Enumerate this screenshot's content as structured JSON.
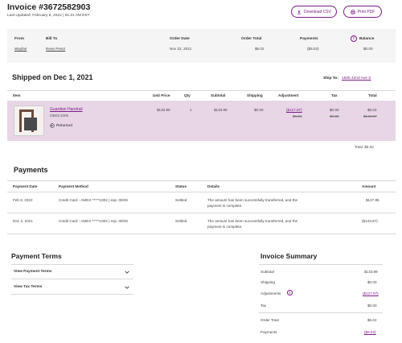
{
  "header": {
    "title": "Invoice #3672582903",
    "last_updated": "Last Updated: February 8, 2022 | 01:21 AM EST",
    "download_csv": "Download CSV",
    "print_pdf": "Print PDF"
  },
  "summary_bar": {
    "from_label": "From",
    "from_value": "Wayfair",
    "bill_to_label": "Bill To",
    "bill_to_value": "Rene Perez",
    "order_date_label": "Order Date",
    "order_date_value": "Nov 22, 2021",
    "order_total_label": "Order Total",
    "order_total_value": "$6.02",
    "payments_label": "Payments",
    "payments_value": "($6.02)",
    "balance_label": "Balance",
    "balance_value": "$0.00"
  },
  "shipment": {
    "heading": "Shipped on Dec 1, 2021",
    "ship_to_label": "Ship To:",
    "ship_to_value": "1505 42nd Ave S",
    "columns": [
      "Item",
      "Unit Price",
      "Qty",
      "Subtotal",
      "Shipping",
      "Adjustment",
      "Tax",
      "Total"
    ],
    "item": {
      "name": "Guardian Handrail",
      "sku": "OBDC1005",
      "status": "Returned",
      "unit_price": "$133.99",
      "qty": "1",
      "subtotal": "$133.99",
      "shipping": "$0.00",
      "adjustment_new": "($127.97)",
      "adjustment_old": "$0.00",
      "tax_new": "$0.00",
      "tax_old": "$9.88",
      "total_new": "$6.02",
      "total_old": "$143.87"
    },
    "total_line": "Total: $6.02"
  },
  "payments": {
    "heading": "Payments",
    "columns": [
      "Payment Date",
      "Payment Method",
      "Status",
      "Details",
      "Amount"
    ],
    "rows": [
      {
        "date": "Feb 8, 2022",
        "method": "Credit Card - AMEX *****1002 | exp. 09/26",
        "status": "Settled",
        "details_line1": "The amount has been successfully transferred, and the",
        "details_line2": "payment is complete.",
        "amount": "$127.85"
      },
      {
        "date": "Dec 2, 2021",
        "method": "Credit Card - AMEX *****1002 | exp. 09/26",
        "status": "Settled",
        "details_line1": "The amount has been successfully transferred, and the",
        "details_line2": "payment is complete.",
        "amount": "($143.87)"
      }
    ]
  },
  "payment_terms": {
    "heading": "Payment Terms",
    "view_payment_terms": "View Payment Terms",
    "view_tax_terms": "View Tax Terms"
  },
  "invoice_summary": {
    "heading": "Invoice Summary",
    "rows": [
      {
        "label": "Subtotal",
        "value": "$133.99"
      },
      {
        "label": "Shipping",
        "value": "$0.00"
      },
      {
        "label": "Adjustments",
        "value": "($127.97)"
      },
      {
        "label": "Tax",
        "value": "$0.00"
      },
      {
        "label": "Order Total",
        "value": "$6.02"
      },
      {
        "label": "Payments",
        "value": "($6.02)"
      }
    ]
  },
  "colors": {
    "accent": "#7b1c86",
    "item_row_bg": "#e8d6e7",
    "summary_bg": "#f5f5f5"
  }
}
